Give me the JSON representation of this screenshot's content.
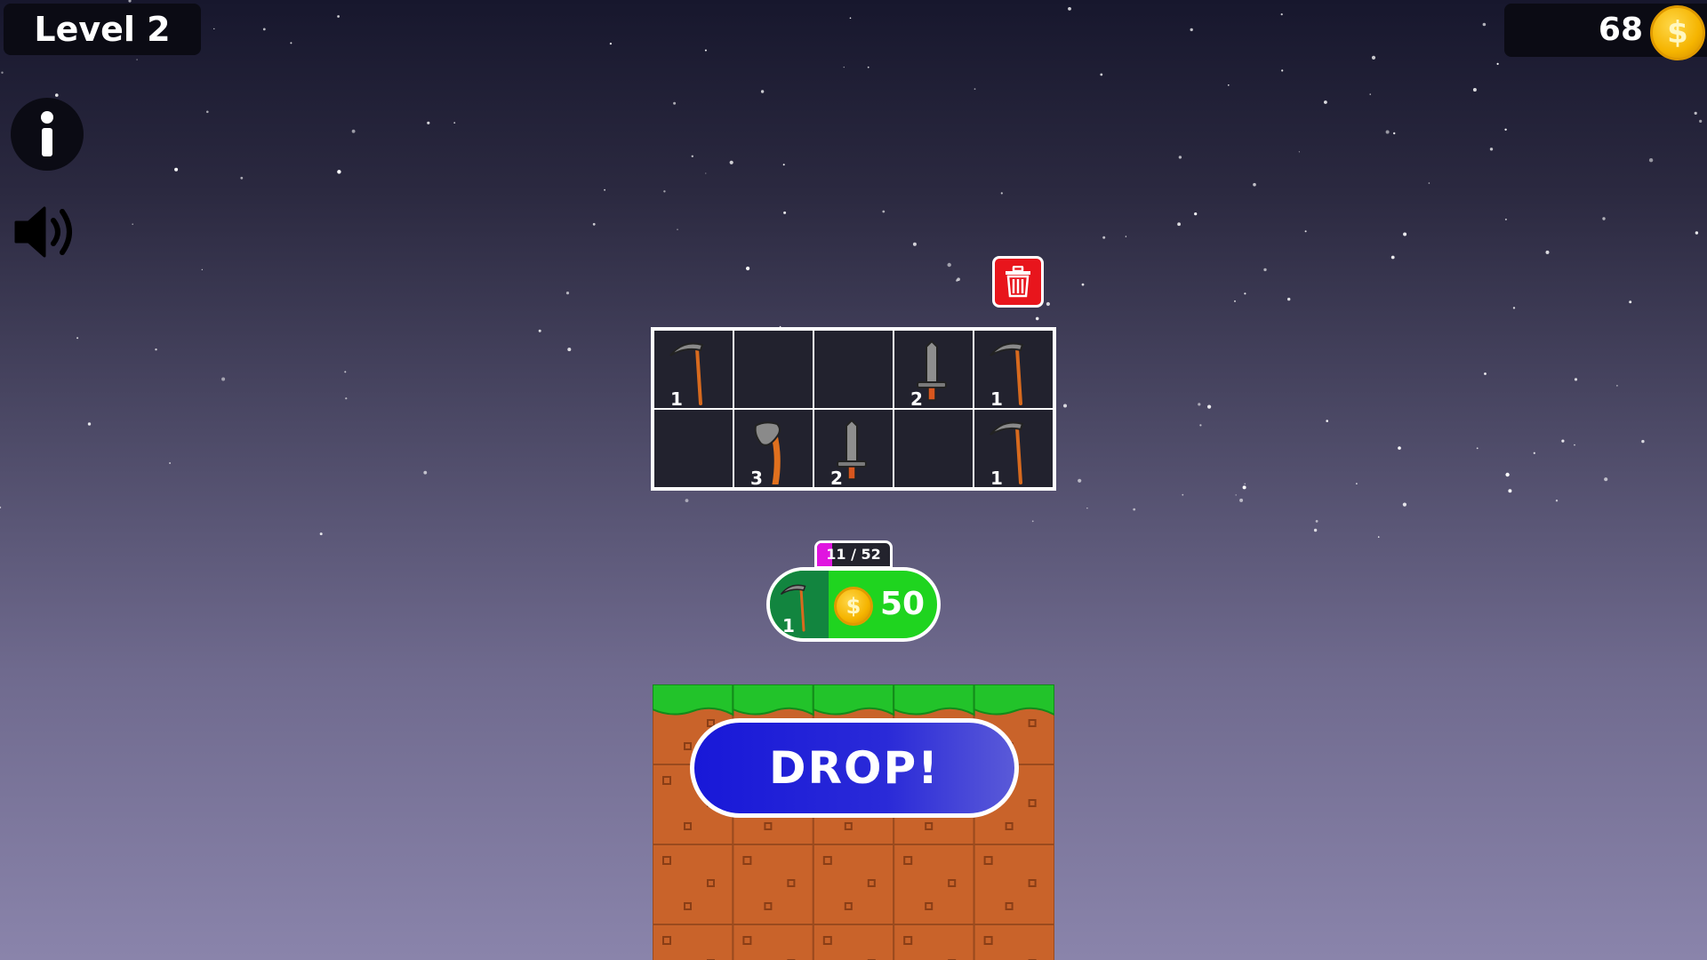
{
  "hud": {
    "level_label": "Level 2",
    "coins": "68",
    "coin_symbol": "$"
  },
  "sidebar": {
    "info_icon": "info-icon",
    "sound_icon": "speaker-icon"
  },
  "trash": {
    "icon": "trash-icon"
  },
  "inventory": {
    "cells": [
      {
        "tool": "scythe",
        "level": "1"
      },
      {
        "tool": "",
        "level": ""
      },
      {
        "tool": "",
        "level": ""
      },
      {
        "tool": "dagger",
        "level": "2"
      },
      {
        "tool": "scythe",
        "level": "1"
      },
      {
        "tool": "",
        "level": ""
      },
      {
        "tool": "axe",
        "level": "3"
      },
      {
        "tool": "dagger",
        "level": "2"
      },
      {
        "tool": "",
        "level": ""
      },
      {
        "tool": "scythe",
        "level": "1"
      }
    ]
  },
  "shop": {
    "progress_text": "11 / 52",
    "progress_current": 11,
    "progress_total": 52,
    "item_tool": "scythe",
    "item_level": "1",
    "price": "50"
  },
  "drop": {
    "label": "DROP!"
  },
  "colors": {
    "grass": "#22c32a",
    "dirt": "#c9632a",
    "buy_green": "#1fd41f",
    "drop_blue": "#1818d8",
    "trash_red": "#e8151c"
  }
}
